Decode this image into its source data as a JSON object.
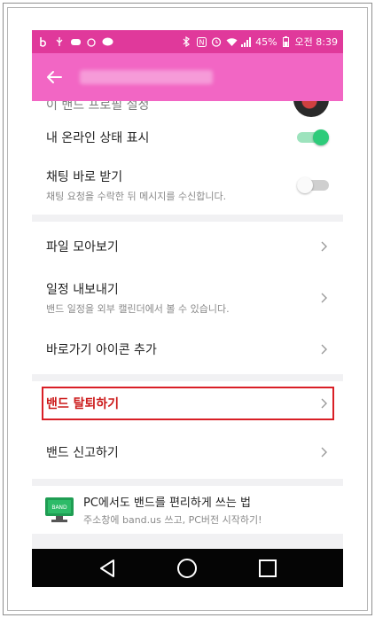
{
  "status_bar": {
    "left_icons": [
      "b-icon",
      "usb-icon",
      "game-icon",
      "alarm-icon",
      "chat-icon",
      "bluetooth-icon",
      "nfc-icon",
      "alarm-clock-icon",
      "wifi-icon",
      "signal-icon"
    ],
    "battery": "45%",
    "battery_icon": "battery-icon",
    "time": "오전 8:39",
    "background": "#e0399b"
  },
  "header": {
    "back_icon": "back-arrow-icon",
    "background": "#f266c4"
  },
  "settings": {
    "partial_label": "이 밴드 프로필 설정",
    "online_status": {
      "label": "내 온라인 상태 표시",
      "on": true
    },
    "direct_chat": {
      "label": "채팅 바로 받기",
      "desc": "채팅 요청을 수락한 뒤 메시지를 수신합니다.",
      "on": false
    },
    "file_collection": {
      "label": "파일 모아보기"
    },
    "export_schedule": {
      "label": "일정 내보내기",
      "desc": "밴드 일정을 외부 캘린더에서 볼 수 있습니다."
    },
    "add_shortcut": {
      "label": "바로가기 아이콘 추가"
    },
    "leave_band": {
      "label": "밴드 탈퇴하기"
    },
    "report_band": {
      "label": "밴드 신고하기"
    }
  },
  "promo": {
    "title": "PC에서도 밴드를 편리하게 쓰는 법",
    "subtitle": "주소창에 band.us 쓰고, PC버전 시작하기!",
    "monitor_text": "BAND"
  },
  "nav_bar": {
    "icons": [
      "back-triangle-icon",
      "home-circle-icon",
      "recents-square-icon"
    ]
  },
  "colors": {
    "toggle_on": "#2ecb7a",
    "highlight": "#d91f26",
    "accent_red": "#cc1a1a"
  }
}
